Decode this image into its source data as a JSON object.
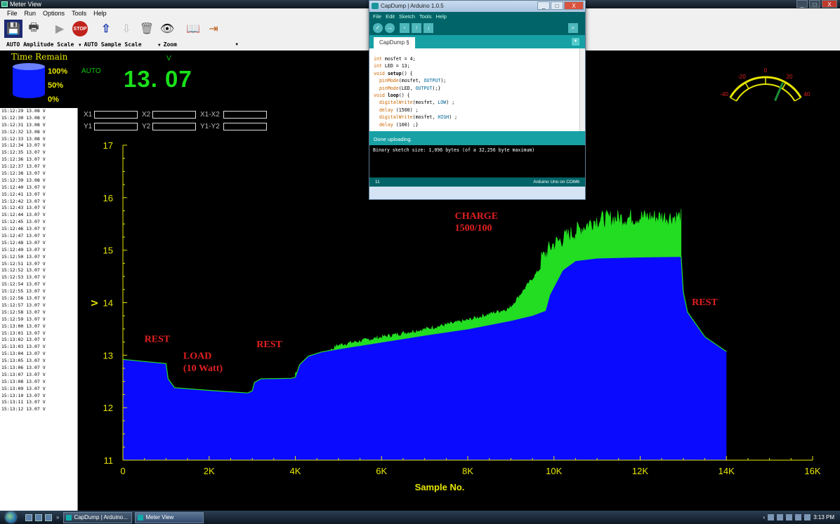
{
  "window": {
    "title": "Meter View",
    "controls": {
      "minimize": "_",
      "maximize": "□",
      "close": "X"
    }
  },
  "menu": [
    "File",
    "Run",
    "Options",
    "Tools",
    "Help"
  ],
  "toolbar": {
    "save": "💾",
    "print": "🖶",
    "run": "▶",
    "stop": "STOP",
    "up": "⇧",
    "down": "⇩",
    "trash": "🗑",
    "binoculars": "👁",
    "book": "📖",
    "exit": "⇥"
  },
  "options": {
    "amplitude_scale": "AUTO Amplitude Scale",
    "sample_scale": "AUTO Sample Scale",
    "zoom": "Zoom"
  },
  "readout": {
    "time_remain_label": "Time Remain",
    "battery_levels": [
      "100%",
      "50%",
      "0%"
    ],
    "auto_label": "AUTO",
    "unit": "V",
    "value": "13. 07"
  },
  "log": [
    "15:12:29   13.08 V",
    "15:12:30   13.08 V",
    "15:12:31   13.08 V",
    "15:12:32   13.08 V",
    "15:12:33   13.08 V",
    "15:12:34   13.07 V",
    "15:12:35   13.07 V",
    "15:12:36   13.07 V",
    "15:12:37   13.07 V",
    "15:12:38   13.07 V",
    "15:12:39   13.08 V",
    "15:12:40   13.07 V",
    "15:12:41   13.07 V",
    "15:12:42   13.07 V",
    "15:12:43   13.07 V",
    "15:12:44   13.07 V",
    "15:12:45   13.07 V",
    "15:12:46   13.07 V",
    "15:12:47   13.07 V",
    "15:12:48   13.07 V",
    "15:12:49   13.07 V",
    "15:12:50   13.07 V",
    "15:12:51   13.07 V",
    "15:12:52   13.07 V",
    "15:12:53   13.07 V",
    "15:12:54   13.07 V",
    "15:12:55   13.07 V",
    "15:12:56   13.07 V",
    "15:12:57   13.07 V",
    "15:12:58   13.07 V",
    "15:12:59   13.07 V",
    "15:13:00   13.07 V",
    "15:13:01   13.07 V",
    "15:13:02   13.07 V",
    "15:13:03   13.07 V",
    "15:13:04   13.07 V",
    "15:13:05   13.07 V",
    "15:13:06   13.07 V",
    "15:13:07   13.07 V",
    "15:13:08   13.07 V",
    "15:13:09   13.07 V",
    "15:13:10   13.07 V",
    "15:13:11   13.07 V",
    "15:13:12   13.07 V"
  ],
  "cursors": {
    "x1": "X1",
    "x2": "X2",
    "x1x2": "X1-X2",
    "y1": "Y1",
    "y2": "Y2",
    "y1y2": "Y1-Y2"
  },
  "gauge": {
    "ticks": [
      "-40",
      "-20",
      "0",
      "20",
      "40"
    ],
    "colors": {
      "arc": "#e6e600",
      "needle": "#1a8f3a"
    }
  },
  "chart_data": {
    "type": "area",
    "xlabel": "Sample No.",
    "ylabel": "V",
    "xlim": [
      0,
      16000
    ],
    "ylim": [
      11,
      17
    ],
    "x_tick_labels": [
      "0",
      "2K",
      "4K",
      "6K",
      "8K",
      "10K",
      "12K",
      "14K",
      "16K"
    ],
    "y_tick_labels": [
      "11",
      "12",
      "13",
      "14",
      "15",
      "16",
      "17"
    ],
    "grid": false,
    "colors": {
      "fill": "#0a0aff",
      "trace": "#22dd22",
      "axis": "#e6e600",
      "annotation": "#e02020"
    },
    "x": [
      0,
      1000,
      1050,
      1200,
      2000,
      2900,
      3000,
      3050,
      3200,
      3900,
      4000,
      4100,
      4300,
      4600,
      5000,
      6000,
      7000,
      8000,
      9000,
      9500,
      9800,
      9900,
      10200,
      10500,
      11000,
      12000,
      12900,
      12950,
      13000,
      13100,
      13500,
      14000
    ],
    "y": [
      12.92,
      12.84,
      12.55,
      12.38,
      12.33,
      12.28,
      12.32,
      12.48,
      12.55,
      12.56,
      12.58,
      12.82,
      12.98,
      13.06,
      13.12,
      13.25,
      13.38,
      13.5,
      13.66,
      13.76,
      13.85,
      14.15,
      14.62,
      14.8,
      14.85,
      14.87,
      14.88,
      14.88,
      14.2,
      13.82,
      13.35,
      13.07
    ],
    "noise_band": {
      "x_start": 4000,
      "x_end": 12950,
      "y_top": [
        12.62,
        13.15,
        13.3,
        13.45,
        13.62,
        13.85,
        14.92,
        15.4,
        15.45,
        15.45
      ]
    },
    "annotations": [
      {
        "text": "REST",
        "x": 500,
        "y": 13.25
      },
      {
        "text": "LOAD",
        "x": 1400,
        "y": 12.93
      },
      {
        "text": "(10 Watt)",
        "x": 1400,
        "y": 12.7
      },
      {
        "text": "REST",
        "x": 3100,
        "y": 13.15
      },
      {
        "text": "CHARGE",
        "x": 7700,
        "y": 15.6
      },
      {
        "text": "1500/100",
        "x": 7700,
        "y": 15.37
      },
      {
        "text": "REST",
        "x": 13200,
        "y": 13.95
      }
    ]
  },
  "arduino": {
    "title": "CapDump | Arduino 1.0.5",
    "controls": {
      "minimize": "_",
      "maximize": "□",
      "close": "X"
    },
    "menu": [
      "File",
      "Edit",
      "Sketch",
      "Tools",
      "Help"
    ],
    "tab": "CapDump §",
    "code": [
      [
        "",
        "int mosfet = 4;"
      ],
      [
        "",
        "int LED = 13;"
      ],
      [
        "kw",
        "void setup() {"
      ],
      [
        "kw",
        "  pinMode(mosfet, OUTPUT);"
      ],
      [
        "kw",
        "  pinMode(LED, OUTPUT);}"
      ],
      [
        "kw",
        "void loop() {"
      ],
      [
        "kw",
        "  digitalWrite(mosfet, LOW) ;"
      ],
      [
        "kw",
        "  delay (1500) ;"
      ],
      [
        "kw",
        "  digitalWrite(mosfet, HIGH) ;"
      ],
      [
        "kw",
        "  delay (100) ;}"
      ]
    ],
    "status": "Done uploading.",
    "console": "Binary sketch size: 1,096 bytes (of a 32,256 byte maximum)",
    "line_number": "11",
    "board": "Arduino Uno on COM6"
  },
  "taskbar": {
    "tasks": [
      "CapDump | Arduino...",
      "Meter View"
    ],
    "clock": "3:13 PM"
  }
}
